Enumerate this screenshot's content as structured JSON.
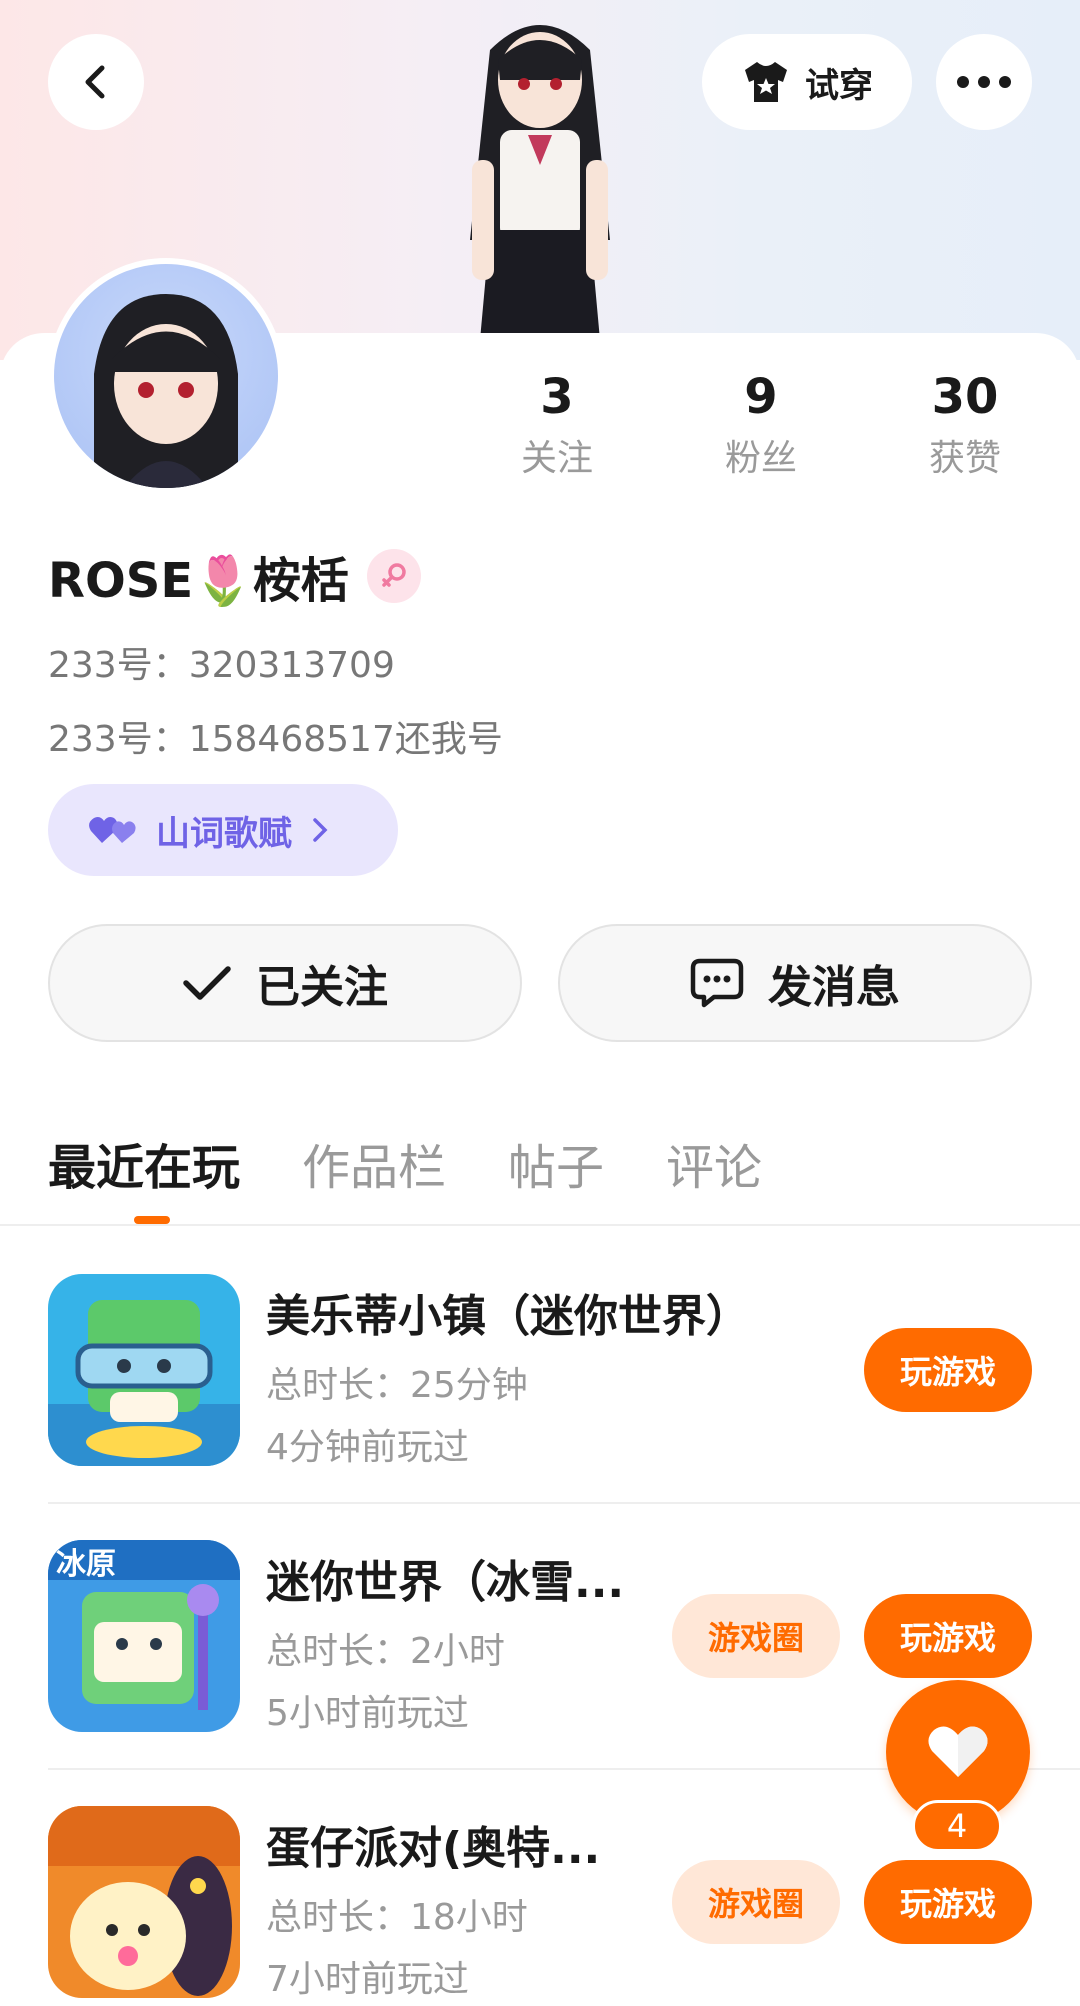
{
  "header": {
    "back_icon": "back-arrow-icon",
    "try_on_label": "试穿",
    "more_icon": "more-dots-icon"
  },
  "profile": {
    "name": "ROSE🌷桉栝",
    "gender": "female",
    "id_line_1": "233号：320313709",
    "id_line_2": "233号：158468517还我号",
    "tag_label": "山词歌赋",
    "stats": [
      {
        "value": "3",
        "label": "关注"
      },
      {
        "value": "9",
        "label": "粉丝"
      },
      {
        "value": "30",
        "label": "获赞"
      }
    ]
  },
  "actions": {
    "follow_label": "已关注",
    "message_label": "发消息"
  },
  "tabs": [
    "最近在玩",
    "作品栏",
    "帖子",
    "评论"
  ],
  "active_tab": "最近在玩",
  "games": [
    {
      "title": "美乐蒂小镇（迷你世界）",
      "duration": "总时长：25分钟",
      "last_played": "4分钟前玩过",
      "has_circle": false
    },
    {
      "title": "迷你世界（冰雪...",
      "duration": "总时长：2小时",
      "last_played": "5小时前玩过",
      "has_circle": true
    },
    {
      "title": "蛋仔派对(奥特...",
      "duration": "总时长：18小时",
      "last_played": "7小时前玩过",
      "has_circle": true
    }
  ],
  "buttons": {
    "play_label": "玩游戏",
    "circle_label": "游戏圈"
  },
  "fab": {
    "icon": "heart-icon",
    "count": "4"
  },
  "colors": {
    "accent": "#ff6b00",
    "accent_light": "#ffe7d7",
    "tag_bg": "#e9e6fd",
    "tag_text": "#6f63e6"
  }
}
